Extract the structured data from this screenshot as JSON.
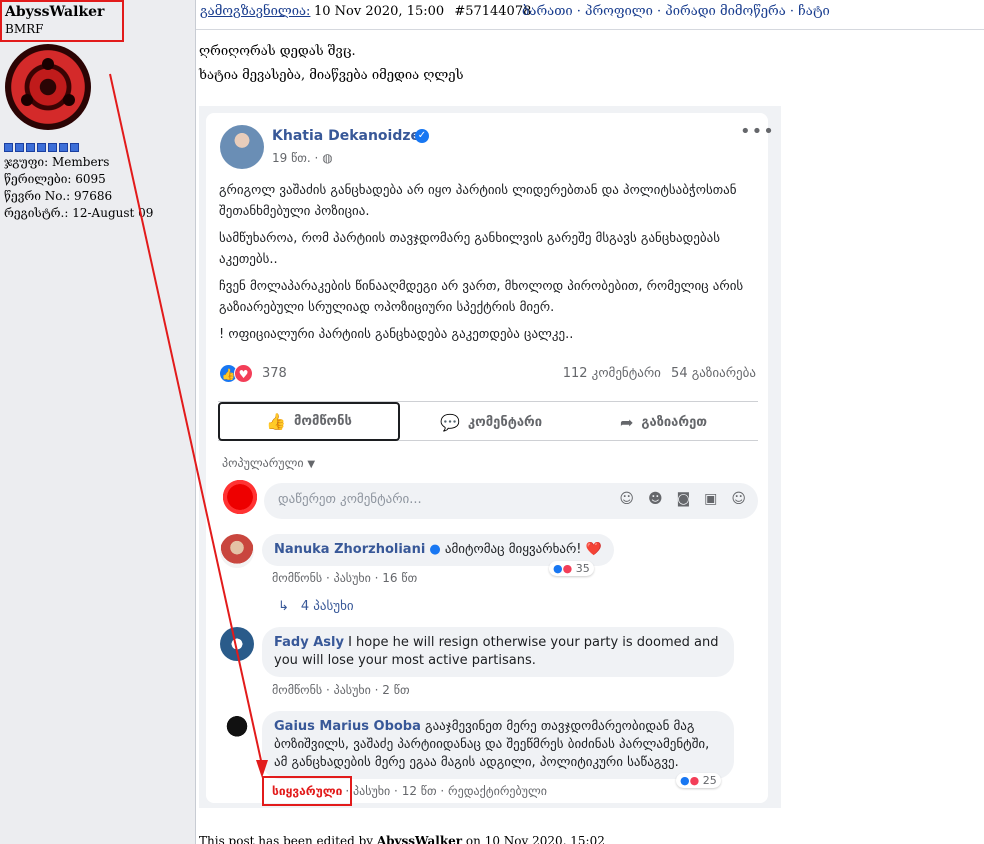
{
  "sidebar": {
    "username": "AbyssWalker",
    "user_title": "BMRF",
    "stats": [
      "ჯგუფი: Members",
      "წერილები: 6095",
      "წევრი No.: 97686",
      "რეგისტრ.: 12-August 09"
    ]
  },
  "post_header": {
    "sent_label": "გამოგზავნილია:",
    "date": "10 Nov 2020, 15:00",
    "post_id": "#57144078",
    "links": "ბარათი · პროფილი · პირადი მიმოწერა · ჩატი"
  },
  "post_text": {
    "line1": "ღრიღორას დედას შვც.",
    "line2": "ხატია მევასება, მიაწვება იმედია ღლეს"
  },
  "fb_post": {
    "author": "Khatia Dekanoidze",
    "time": "19 წთ. ·",
    "paragraphs": [
      "გრიგოლ ვაშაძის განცხადება არ იყო პარტიის ლიდერებთან და პოლიტსაბჭოსთან შეთანხმებული პოზიცია.",
      "სამწუხაროა, რომ პარტიის თავჯდომარე განხილვის გარეშე მსგავს განცხადებას აკეთებს..",
      "ჩვენ მოლაპარაკების წინააღმდეგი არ ვართ, მხოლოდ პირობებით, რომელიც არის გაზიარებული სრულიად ოპოზიციური სპექტრის მიერ.",
      "! ოფიციალური პარტიის განცხადება გაკეთდება ცალკე.."
    ],
    "reaction_count": "378",
    "comments_count": "112 კომენტარი",
    "shares_count": "54 გაზიარება",
    "actions": {
      "like": "მომწონს",
      "comment": "კომენტარი",
      "share": "გაზიარეთ"
    },
    "sort_label": "პოპულარული",
    "comment_placeholder": "დაწერეთ კომენტარი..."
  },
  "comments": [
    {
      "name": "Nanuka Zhorzholiani",
      "text": "ამიტომაც მიყვარხარ! ❤️",
      "like": "მომწონს",
      "reply": "პასუხი",
      "time": "16 წთ",
      "reactions": "35",
      "replies": "4 პასუხი"
    },
    {
      "name": "Fady Asly",
      "text": "I hope he will resign otherwise your party is doomed and you will lose your most active partisans.",
      "like": "მომწონს",
      "reply": "პასუხი",
      "time": "2 წთ"
    },
    {
      "name": "Gaius Marius Oboba",
      "text": "გააჯმევინეთ მერე თავჯდომარეობიდან მაგ ბოზიშვილს, ვაშაძე პარტიიდანაც და შეეწმრეს ბიძინას პარლამენტში, ამ განცხადების მერე ეგაა მაგის ადგილი, პოლიტიკური საწაგვე.",
      "like": "სიყვარული",
      "reply": "პასუხი",
      "time": "12 წთ",
      "edited": "რედაქტირებული",
      "reactions": "25"
    }
  ],
  "edit_note": {
    "prefix": "This post has been edited by",
    "editor": "AbyssWalker",
    "suffix": "on 10 Nov 2020, 15:02"
  },
  "colors": {
    "fb_blue": "#1877f2",
    "link_blue": "#385898",
    "annotation_red": "#e21b1b",
    "rank_blue": "#3d6fd8"
  }
}
